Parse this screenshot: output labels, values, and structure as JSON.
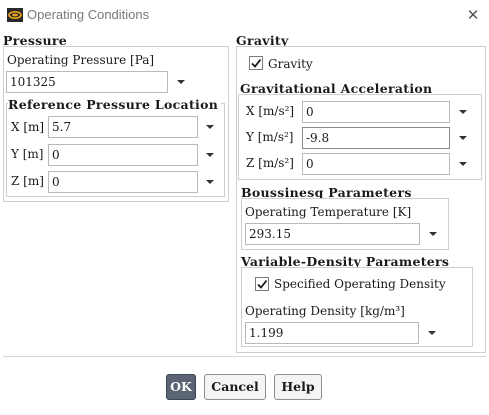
{
  "window": {
    "title": "Operating Conditions",
    "icon": "ansys-fluent-icon",
    "close_icon": "close-icon"
  },
  "pressure": {
    "section_title": "Pressure",
    "operating_pressure_label": "Operating Pressure [Pa]",
    "operating_pressure_value": "101325",
    "reference_location_title": "Reference Pressure Location",
    "x_label": "X [m]",
    "x_value": "5.7",
    "y_label": "Y [m]",
    "y_value": "0",
    "z_label": "Z [m]",
    "z_value": "0"
  },
  "gravity": {
    "section_title": "Gravity",
    "checkbox_label": "Gravity",
    "checked": true,
    "acceleration_title": "Gravitational Acceleration",
    "x_label": "X [m/s²]",
    "x_value": "0",
    "y_label": "Y [m/s²]",
    "y_value": "-9.8",
    "z_label": "Z [m/s²]",
    "z_value": "0"
  },
  "boussinesq": {
    "title": "Boussinesq Parameters",
    "operating_temperature_label": "Operating Temperature [K]",
    "operating_temperature_value": "293.15"
  },
  "variable_density": {
    "title": "Variable-Density Parameters",
    "specified_density_label": "Specified Operating Density",
    "specified_density_checked": true,
    "operating_density_label": "Operating Density [kg/m³]",
    "operating_density_value": "1.199"
  },
  "buttons": {
    "ok": "OK",
    "cancel": "Cancel",
    "help": "Help"
  },
  "colors": {
    "ok_button_bg": "#5a6472",
    "group_border": "#cfcfcf"
  }
}
